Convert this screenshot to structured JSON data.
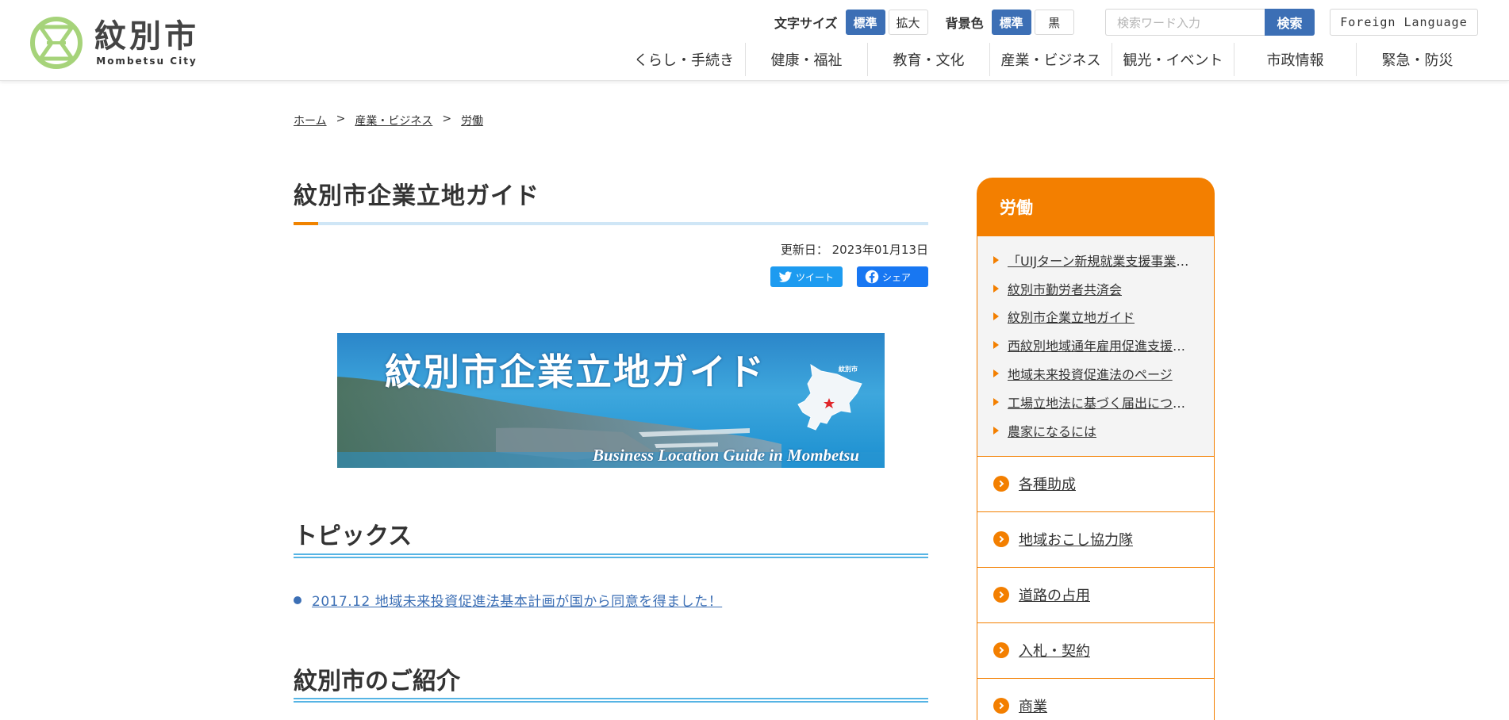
{
  "site": {
    "name_jp": "紋別市",
    "name_en": "Mombetsu City"
  },
  "utility": {
    "font_size_label": "文字サイズ",
    "font_standard": "標準",
    "font_large": "拡大",
    "bg_label": "背景色",
    "bg_standard": "標準",
    "bg_black": "黒",
    "search_placeholder": "検索ワード入力",
    "search_button": "検索",
    "foreign_language": "Foreign Language"
  },
  "global_nav": [
    {
      "label": "くらし・手続き"
    },
    {
      "label": "健康・福祉"
    },
    {
      "label": "教育・文化"
    },
    {
      "label": "産業・ビジネス"
    },
    {
      "label": "観光・イベント"
    },
    {
      "label": "市政情報"
    },
    {
      "label": "緊急・防災"
    }
  ],
  "breadcrumb": {
    "home": "ホーム",
    "sep": ">",
    "parent": "産業・ビジネス",
    "current": "労働"
  },
  "article": {
    "title": "紋別市企業立地ガイド",
    "updated_label": "更新日：",
    "updated_date": "2023年01月13日",
    "tweet_label": "ツイート",
    "share_label": "シェア",
    "banner_title": "紋別市企業立地ガイド",
    "banner_subtitle": "Business Location Guide in Mombetsu",
    "banner_map_label": "紋別市",
    "section_topics": "トピックス",
    "topic_link": "2017.12 地域未来投資促進法基本計画が国から同意を得ました！",
    "section_intro": "紋別市のご紹介"
  },
  "sidebar": {
    "heading": "労働",
    "items": [
      {
        "label": "「UIJターン新規就業支援事業」について"
      },
      {
        "label": "紋別市勤労者共済会"
      },
      {
        "label": "紋別市企業立地ガイド"
      },
      {
        "label": "西紋別地域通年雇用促進支援協議会"
      },
      {
        "label": "地域未来投資促進法のページ"
      },
      {
        "label": "工場立地法に基づく届出について"
      },
      {
        "label": "農家になるには"
      }
    ],
    "categories": [
      {
        "label": "各種助成"
      },
      {
        "label": "地域おこし協力隊"
      },
      {
        "label": "道路の占用"
      },
      {
        "label": "入札・契約"
      },
      {
        "label": "商業"
      }
    ]
  },
  "colors": {
    "accent_orange": "#f37f00",
    "primary_blue": "#3c6fb5",
    "logo_green": "#a6d37a"
  }
}
